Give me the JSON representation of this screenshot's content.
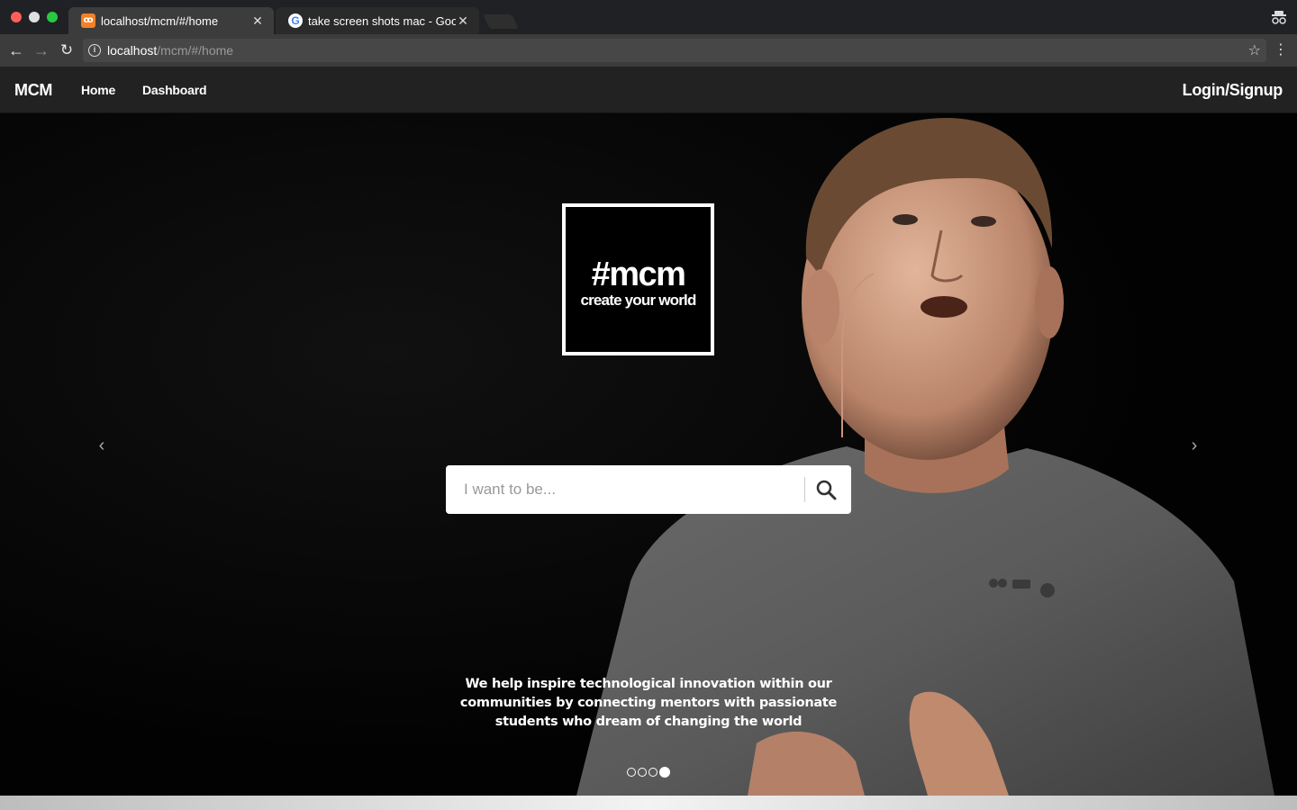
{
  "browser": {
    "tabs": [
      {
        "label": "localhost/mcm/#/home",
        "favicon": "xampp-icon",
        "active": true
      },
      {
        "label": "take screen shots mac - Googl",
        "favicon": "google-icon",
        "active": false
      }
    ],
    "tab_close_glyph": "✕",
    "url_host": "localhost",
    "url_path": "/mcm/#/home"
  },
  "navbar": {
    "brand": "MCM",
    "links": [
      "Home",
      "Dashboard"
    ],
    "login_label": "Login/Signup"
  },
  "hero": {
    "logo_hashtag": "#mcm",
    "logo_tagline": "create your world",
    "search_placeholder": "I want to be...",
    "tagline": "We help inspire technological innovation within our communities by connecting mentors with passionate students who dream of changing the world",
    "carousel": {
      "slide_count": 4,
      "active_index": 3
    }
  },
  "colors": {
    "chrome_dark": "#202124",
    "toolbar": "#3c3c3c",
    "navbar": "#222222",
    "accent_white": "#ffffff"
  }
}
